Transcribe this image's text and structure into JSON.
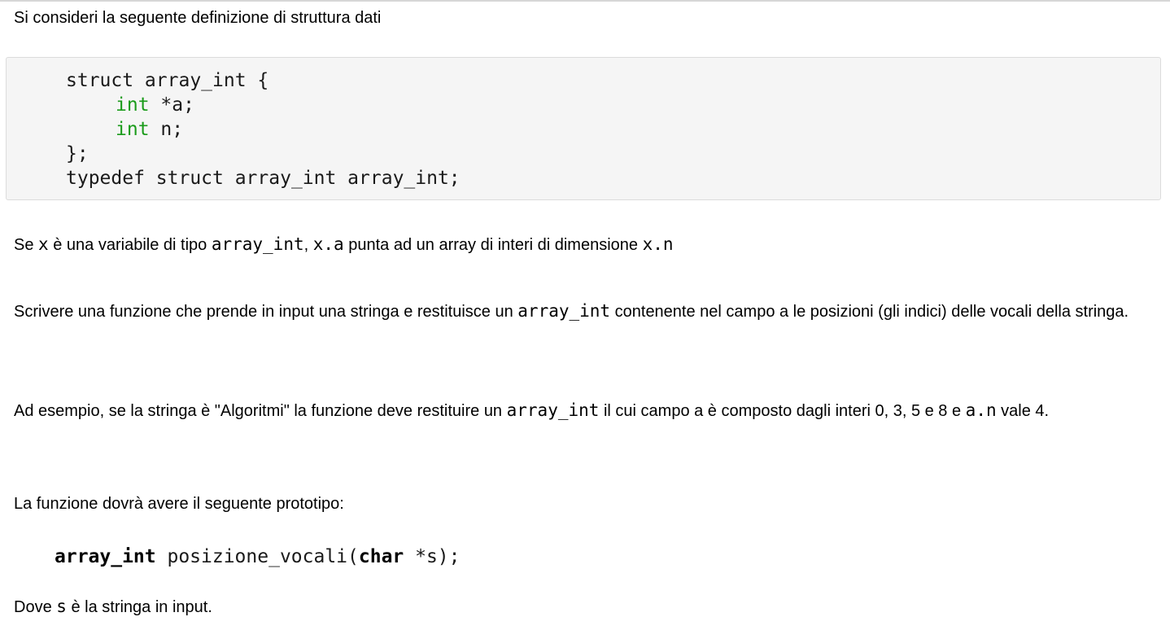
{
  "intro": {
    "text": "Si consideri la seguente definizione di struttura dati"
  },
  "code": {
    "l1": "struct array_int {",
    "l2_type": "int",
    "l2_rest": " *a;",
    "l3_type": "int",
    "l3_rest": " n;",
    "l4": "};",
    "l5": "typedef struct array_int array_int;"
  },
  "p1": {
    "t1": "Se ",
    "c1": "x",
    "t2": " è una variabile di tipo ",
    "c2": "array_int",
    "t3": ", ",
    "c3": "x.a",
    "t4": " punta ad un array di interi di dimensione ",
    "c4": "x.n"
  },
  "p2": {
    "t1": "Scrivere una funzione che prende in input una stringa e restituisce un ",
    "c1": "array_int",
    "t2": " contenente nel campo a le posizioni (gli indici) delle vocali della stringa."
  },
  "p3": {
    "t1": "Ad esempio, se la stringa è \"Algoritmi\" la funzione deve restituire un ",
    "c1": "array_int",
    "t2": " il cui campo a è composto dagli interi 0, 3, 5 e 8 e ",
    "c2": "a.n",
    "t3": " vale 4."
  },
  "p4": {
    "text": "La funzione dovrà avere il seguente prototipo:"
  },
  "prototype": {
    "ret_type": "array_int",
    "name": " posizione_vocali(",
    "arg_type": "char",
    "rest": " *s);"
  },
  "p5": {
    "t1": "Dove ",
    "c1": "s",
    "t2": " è la stringa in input."
  }
}
